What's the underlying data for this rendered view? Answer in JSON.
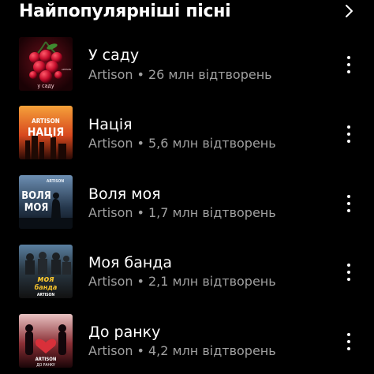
{
  "section": {
    "title": "Найпопулярніші пісні"
  },
  "songs": [
    {
      "title": "У саду",
      "artist": "Artison",
      "separator": "•",
      "plays": "26 млн відтворень",
      "cover": {
        "art_title": "у саду",
        "art_artist": "ARTISON",
        "accent": "#c8102e"
      }
    },
    {
      "title": "Нація",
      "artist": "Artison",
      "separator": "•",
      "plays": "5,6 млн відтворень",
      "cover": {
        "art_title": "НАЦІЯ",
        "art_artist": "ARTISON",
        "accent": "#f08a2a"
      }
    },
    {
      "title": "Воля моя",
      "artist": "Artison",
      "separator": "•",
      "plays": "1,7 млн відтворень",
      "cover": {
        "art_title_1": "ВОЛЯ",
        "art_title_2": "МОЯ",
        "art_artist": "ARTISON",
        "accent": "#3a5f8a"
      }
    },
    {
      "title": "Моя банда",
      "artist": "Artison",
      "separator": "•",
      "plays": "2,1 млн відтворень",
      "cover": {
        "art_title_1": "моя",
        "art_title_2": "банда",
        "art_artist": "ARTISON",
        "accent": "#f2c12e"
      }
    },
    {
      "title": "До ранку",
      "artist": "Artison",
      "separator": "•",
      "plays": "4,2 млн відтворень",
      "cover": {
        "art_artist": "ARTISON",
        "art_title": "ДО РАНКУ",
        "accent": "#d9303a"
      }
    }
  ],
  "icons": {
    "header_action": "chevron-right-icon",
    "row_action": "more-vertical-icon"
  }
}
